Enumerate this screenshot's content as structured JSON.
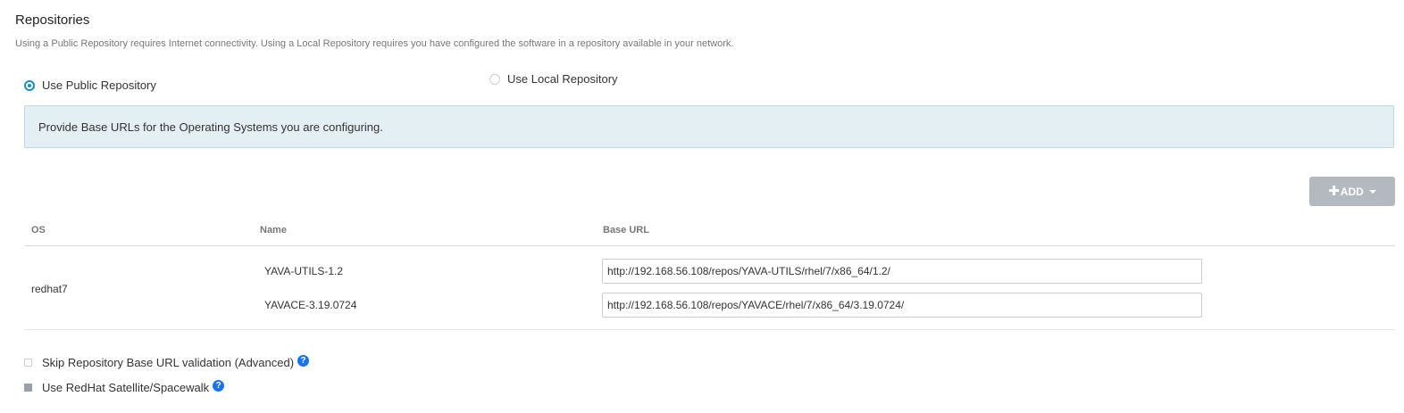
{
  "repositories": {
    "title": "Repositories",
    "description": "Using a Public Repository requires Internet connectivity. Using a Local Repository requires you have configured the software in a repository available in your network."
  },
  "repo_choice": {
    "public_label": "Use Public Repository",
    "local_label": "Use Local Repository",
    "selected": "public"
  },
  "info_box": {
    "text": "Provide Base URLs for the Operating Systems you are configuring."
  },
  "add_button": {
    "label": "ADD",
    "plus_icon": "plus-icon",
    "caret_icon": "caret-down-icon"
  },
  "table": {
    "headers": {
      "os": "OS",
      "name": "Name",
      "base_url": "Base URL"
    },
    "rows": [
      {
        "os": "redhat7",
        "repos": [
          {
            "name": "YAVA-UTILS-1.2",
            "base_url": "http://192.168.56.108/repos/YAVA-UTILS/rhel/7/x86_64/1.2/"
          },
          {
            "name": "YAVACE-3.19.0724",
            "base_url": "http://192.168.56.108/repos/YAVACE/rhel/7/x86_64/3.19.0724/"
          }
        ]
      }
    ]
  },
  "options": {
    "skip_validation_label": "Skip Repository Base URL validation (Advanced)",
    "skip_validation_checked": false,
    "satellite_label": "Use RedHat Satellite/Spacewalk",
    "satellite_checked": false,
    "help_glyph": "?",
    "help_icon": "question-circle-icon"
  },
  "colors": {
    "accent": "#1a8dbb",
    "info_bg": "#e4eff4",
    "add_button_bg": "#b3b9bf",
    "help_icon": "#1a73e8"
  }
}
